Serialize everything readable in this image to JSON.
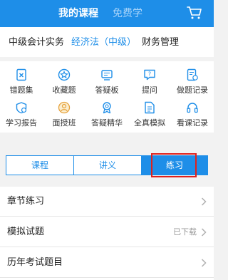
{
  "header": {
    "tabs": [
      {
        "label": "我的课程",
        "active": true
      },
      {
        "label": "免费学",
        "active": false
      }
    ],
    "cart_icon": "cart-icon",
    "background": "#1e8ee8"
  },
  "subjects": [
    {
      "label": "中级会计实务",
      "selected": false
    },
    {
      "label": "经济法（中级）",
      "selected": true
    },
    {
      "label": "财务管理",
      "selected": false
    }
  ],
  "grid": [
    {
      "label": "错题集",
      "icon": "wrong-questions-icon"
    },
    {
      "label": "收藏题",
      "icon": "favorites-icon"
    },
    {
      "label": "答疑板",
      "icon": "qa-board-icon"
    },
    {
      "label": "提问",
      "icon": "ask-question-icon"
    },
    {
      "label": "做题记录",
      "icon": "practice-record-icon"
    },
    {
      "label": "学习报告",
      "icon": "study-report-icon"
    },
    {
      "label": "面授班",
      "icon": "classroom-icon"
    },
    {
      "label": "答疑精华",
      "icon": "qa-highlights-icon"
    },
    {
      "label": "全真模拟",
      "icon": "mock-exam-icon"
    },
    {
      "label": "看课记录",
      "icon": "watch-history-icon"
    }
  ],
  "segments": [
    {
      "label": "课程",
      "selected": false
    },
    {
      "label": "讲义",
      "selected": false
    },
    {
      "label": "练习",
      "selected": true
    }
  ],
  "list": [
    {
      "title": "章节练习",
      "status": ""
    },
    {
      "title": "模拟试题",
      "status": "已下载"
    },
    {
      "title": "历年考试题目",
      "status": ""
    }
  ],
  "colors": {
    "accent": "#1e8ee8",
    "highlight": "#e0211c"
  }
}
